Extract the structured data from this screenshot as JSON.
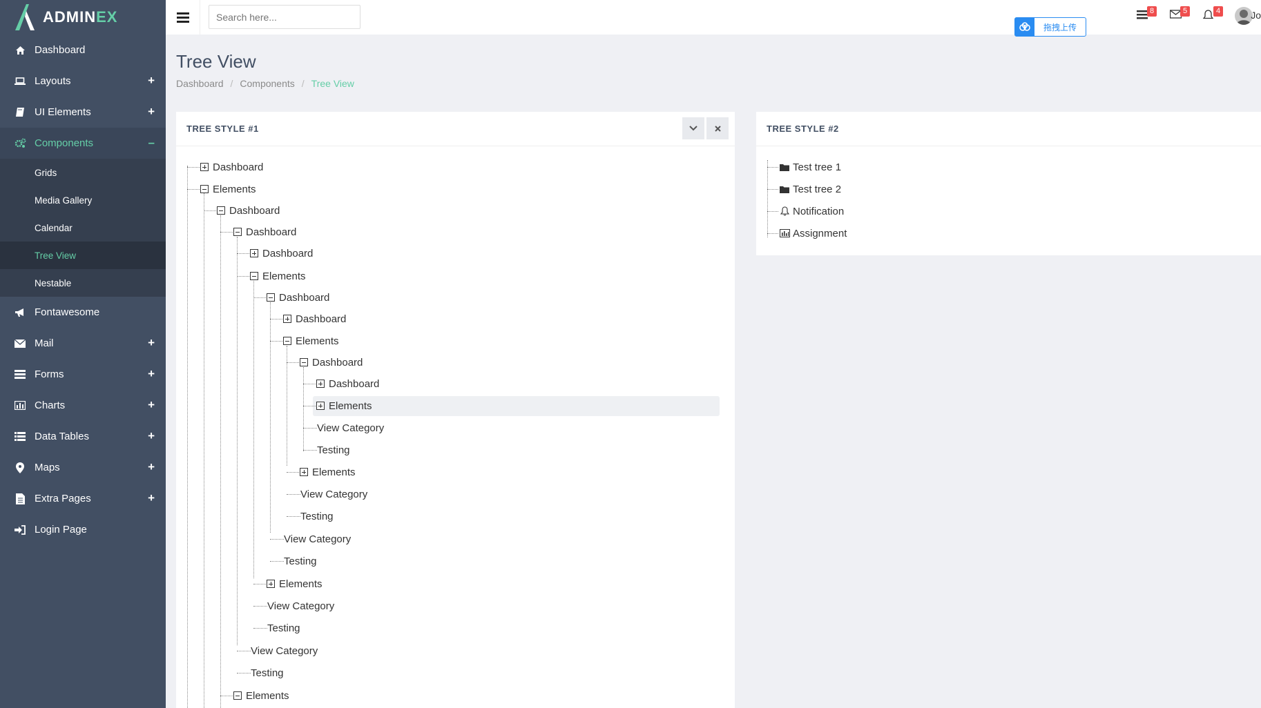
{
  "brand": {
    "part1": "ADMIN",
    "part2": "EX"
  },
  "sidebar": {
    "items": [
      {
        "label": "Dashboard",
        "icon": "home-icon"
      },
      {
        "label": "Layouts",
        "icon": "laptop-icon",
        "toggle": "+"
      },
      {
        "label": "UI Elements",
        "icon": "book-icon",
        "toggle": "+"
      },
      {
        "label": "Components",
        "icon": "cogs-icon",
        "toggle": "–"
      },
      {
        "label": "Fontawesome",
        "icon": "bullhorn-icon"
      },
      {
        "label": "Mail",
        "icon": "envelope-icon",
        "toggle": "+"
      },
      {
        "label": "Forms",
        "icon": "tasks-icon",
        "toggle": "+"
      },
      {
        "label": "Charts",
        "icon": "bar-chart-icon",
        "toggle": "+"
      },
      {
        "label": "Data Tables",
        "icon": "table-icon",
        "toggle": "+"
      },
      {
        "label": "Maps",
        "icon": "map-marker-icon",
        "toggle": "+"
      },
      {
        "label": "Extra Pages",
        "icon": "file-icon",
        "toggle": "+"
      },
      {
        "label": "Login Page",
        "icon": "sign-in-icon"
      }
    ],
    "submenu": [
      "Grids",
      "Media Gallery",
      "Calendar",
      "Tree View",
      "Nestable"
    ]
  },
  "header": {
    "search_placeholder": "Search here...",
    "badges": {
      "tasks": "8",
      "mail": "5",
      "notifications": "4"
    },
    "user_initial": "Jo",
    "upload_label": "拖拽上传"
  },
  "page": {
    "title": "Tree View",
    "breadcrumb": [
      "Dashboard",
      "Components",
      "Tree View"
    ]
  },
  "panel1": {
    "title": "TREE STYLE #1",
    "nodes": [
      {
        "label": "Dashboard"
      },
      {
        "label": "Elements"
      },
      {
        "label": "Dashboard"
      },
      {
        "label": "Dashboard"
      },
      {
        "label": "Dashboard"
      },
      {
        "label": "Elements"
      },
      {
        "label": "Dashboard"
      },
      {
        "label": "Dashboard"
      },
      {
        "label": "Elements"
      },
      {
        "label": "Dashboard"
      },
      {
        "label": "Dashboard"
      },
      {
        "label": "Elements"
      },
      {
        "label": "View Category"
      },
      {
        "label": "Testing"
      },
      {
        "label": "Elements"
      },
      {
        "label": "View Category"
      },
      {
        "label": "Testing"
      },
      {
        "label": "View Category"
      },
      {
        "label": "Testing"
      },
      {
        "label": "Elements"
      },
      {
        "label": "View Category"
      },
      {
        "label": "Testing"
      },
      {
        "label": "View Category"
      },
      {
        "label": "Testing"
      },
      {
        "label": "Elements"
      }
    ]
  },
  "panel2": {
    "title": "TREE STYLE #2",
    "nodes": [
      {
        "label": "Test tree 1",
        "icon": "folder-icon"
      },
      {
        "label": "Test tree 2",
        "icon": "folder-icon"
      },
      {
        "label": "Notification",
        "icon": "bell-icon"
      },
      {
        "label": "Assignment",
        "icon": "bar-chart-icon"
      }
    ]
  },
  "colors": {
    "accent": "#65cea7",
    "sidebar": "#424f63",
    "badge": "#ef4d4d"
  }
}
